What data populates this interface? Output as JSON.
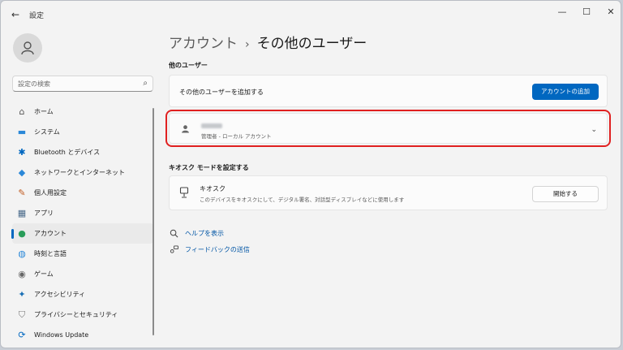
{
  "window": {
    "title": "設定",
    "back": "←",
    "minimize": "—",
    "maximize": "☐",
    "close": "✕"
  },
  "search": {
    "placeholder": "設定の検索",
    "icon": "⌕"
  },
  "sidebar": {
    "items": [
      {
        "label": "ホーム",
        "icon": "home-icon",
        "glyph": "⌂",
        "color": "#555555",
        "active": false
      },
      {
        "label": "システム",
        "icon": "system-icon",
        "glyph": "▬",
        "color": "#2b88d8",
        "active": false
      },
      {
        "label": "Bluetooth とデバイス",
        "icon": "bluetooth-icon",
        "glyph": "✱",
        "color": "#0067c0",
        "active": false
      },
      {
        "label": "ネットワークとインターネット",
        "icon": "network-icon",
        "glyph": "◆",
        "color": "#2b88d8",
        "active": false
      },
      {
        "label": "個人用設定",
        "icon": "brush-icon",
        "glyph": "✎",
        "color": "#c05a20",
        "active": false
      },
      {
        "label": "アプリ",
        "icon": "apps-icon",
        "glyph": "▦",
        "color": "#4a6a8a",
        "active": false
      },
      {
        "label": "アカウント",
        "icon": "account-icon",
        "glyph": "●",
        "color": "#2a9d5a",
        "active": true
      },
      {
        "label": "時刻と言語",
        "icon": "globe-icon",
        "glyph": "◍",
        "color": "#2b88d8",
        "active": false
      },
      {
        "label": "ゲーム",
        "icon": "gamepad-icon",
        "glyph": "◉",
        "color": "#666666",
        "active": false
      },
      {
        "label": "アクセシビリティ",
        "icon": "accessibility-icon",
        "glyph": "✦",
        "color": "#1a6fb5",
        "active": false
      },
      {
        "label": "プライバシーとセキュリティ",
        "icon": "shield-icon",
        "glyph": "⛉",
        "color": "#777777",
        "active": false
      },
      {
        "label": "Windows Update",
        "icon": "update-icon",
        "glyph": "⟳",
        "color": "#0067c0",
        "active": false
      }
    ]
  },
  "breadcrumb": {
    "parent": "アカウント",
    "separator": "›",
    "current": "その他のユーザー"
  },
  "other_users": {
    "heading": "他のユーザー",
    "add_text": "その他のユーザーを追加する",
    "add_button": "アカウントの追加",
    "user": {
      "role": "管理者 - ローカル アカウント"
    }
  },
  "kiosk": {
    "heading": "キオスク モードを設定する",
    "title": "キオスク",
    "description": "このデバイスをキオスクにして、デジタル署名、対話型ディスプレイなどに使用します",
    "button": "開始する"
  },
  "links": {
    "help": "ヘルプを表示",
    "feedback": "フィードバックの送信"
  },
  "colors": {
    "accent": "#0067c0",
    "highlight": "#e02020"
  }
}
